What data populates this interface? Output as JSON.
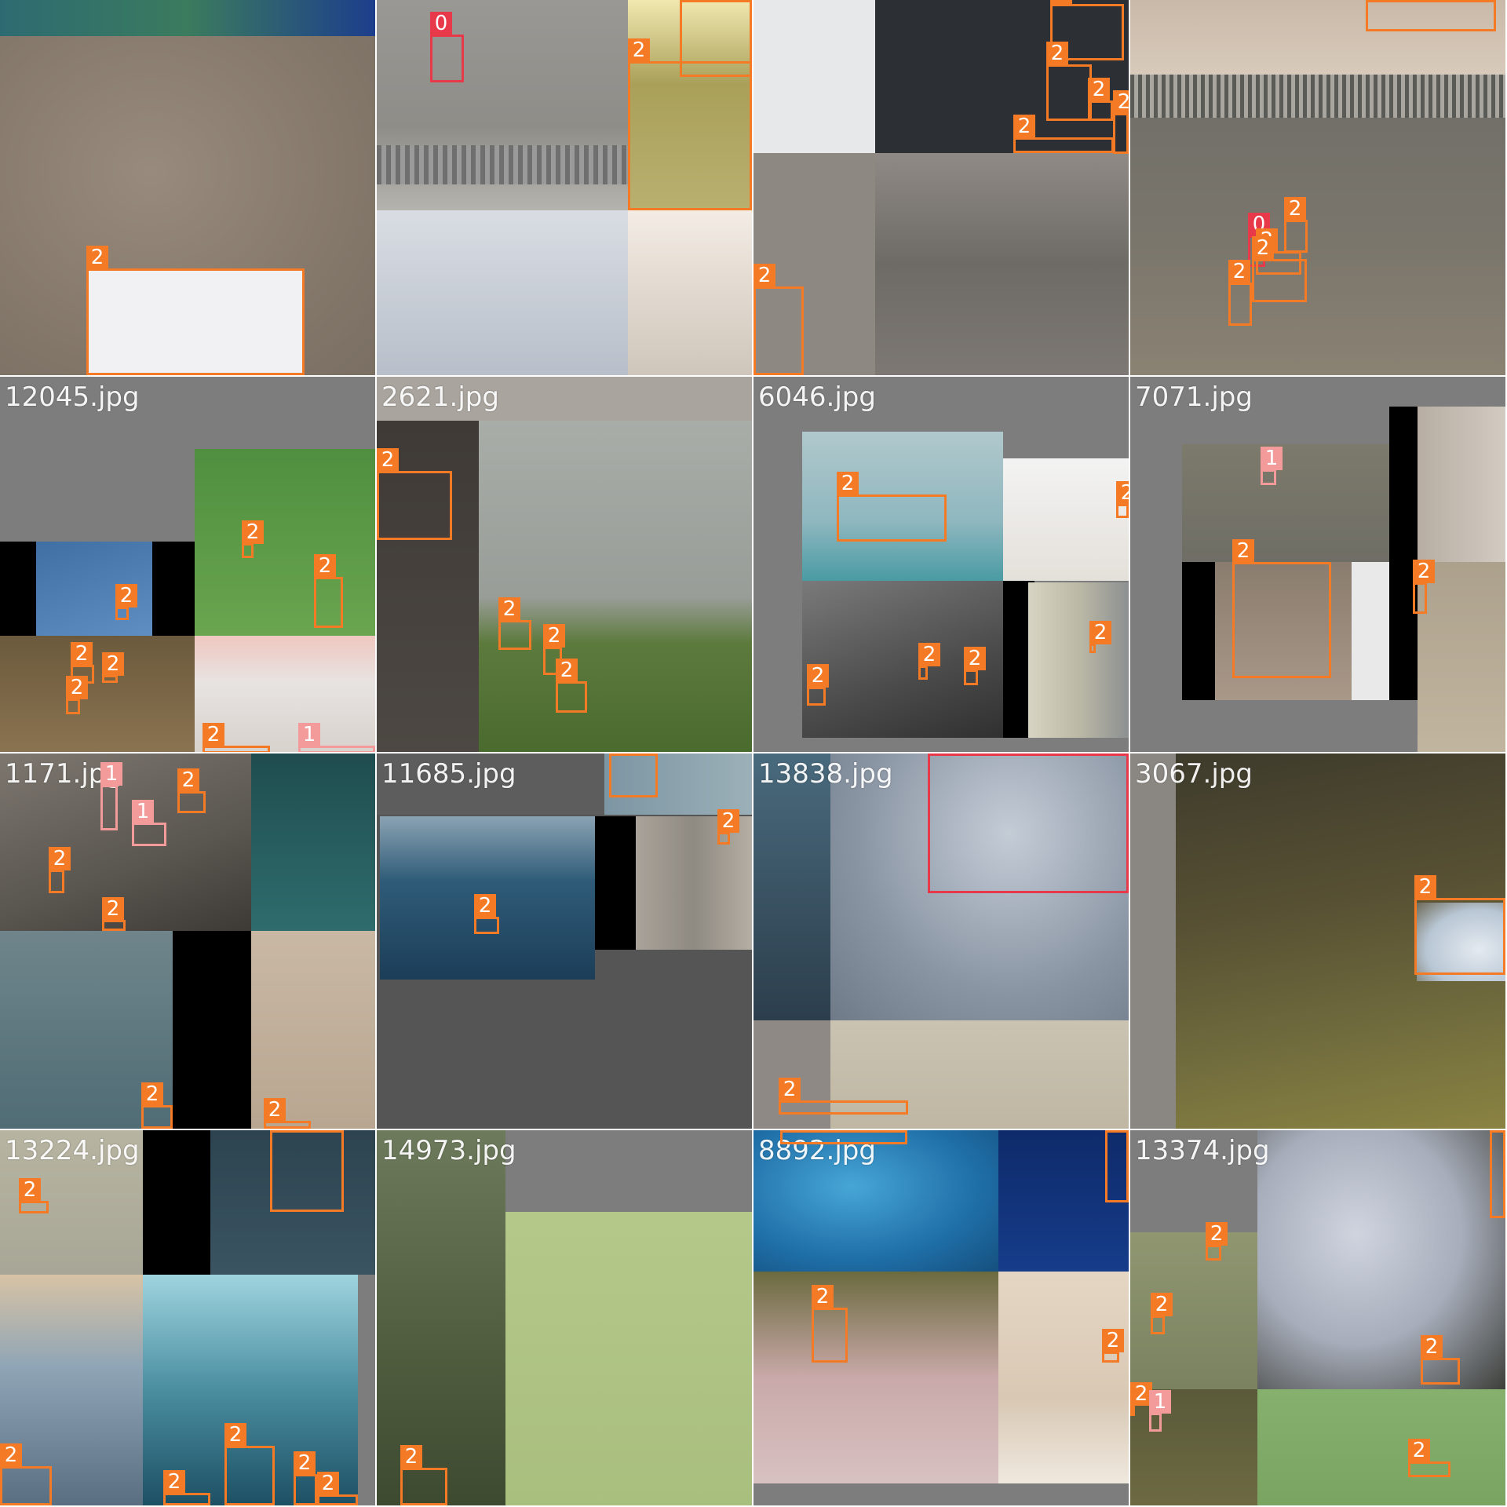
{
  "mosaic": {
    "tiles": [
      {
        "filename": "",
        "boxes": [
          "2"
        ]
      },
      {
        "filename": "",
        "boxes": [
          "0",
          "2",
          "2"
        ]
      },
      {
        "filename": "",
        "boxes": [
          "2",
          "2",
          "2",
          "2",
          "2",
          "2"
        ]
      },
      {
        "filename": "",
        "boxes": [
          "2",
          "0",
          "2",
          "2",
          "2",
          "2"
        ]
      },
      {
        "filename": "12045.jpg",
        "boxes": [
          "2",
          "2",
          "2",
          "2",
          "2",
          "2",
          "2",
          "1"
        ]
      },
      {
        "filename": "2621.jpg",
        "boxes": [
          "2",
          "2",
          "2",
          "2"
        ]
      },
      {
        "filename": "6046.jpg",
        "boxes": [
          "2",
          "2",
          "2",
          "2",
          "2",
          "2"
        ]
      },
      {
        "filename": "7071.jpg",
        "boxes": [
          "1",
          "2",
          "2"
        ]
      },
      {
        "filename": "1171.jpg",
        "boxes": [
          "1",
          "1",
          "2",
          "2",
          "2",
          "2",
          "2"
        ]
      },
      {
        "filename": "11685.jpg",
        "boxes": [
          "2",
          "2",
          "2"
        ]
      },
      {
        "filename": "13838.jpg",
        "boxes": [
          "0",
          "2"
        ]
      },
      {
        "filename": "3067.jpg",
        "boxes": [
          "2"
        ]
      },
      {
        "filename": "13224.jpg",
        "boxes": [
          "2",
          "2",
          "2",
          "2",
          "2",
          "2",
          "2"
        ]
      },
      {
        "filename": "14973.jpg",
        "boxes": [
          "2"
        ]
      },
      {
        "filename": "8892.jpg",
        "boxes": [
          "2",
          "2",
          "2",
          "2"
        ]
      },
      {
        "filename": "13374.jpg",
        "boxes": [
          "2",
          "2",
          "2",
          "2",
          "2",
          "1",
          "2"
        ]
      }
    ]
  },
  "colors": {
    "class_0": "#e8394a",
    "class_1": "#f39a9a",
    "class_2": "#f47a25",
    "pad_gray": "#7d7d7d"
  }
}
